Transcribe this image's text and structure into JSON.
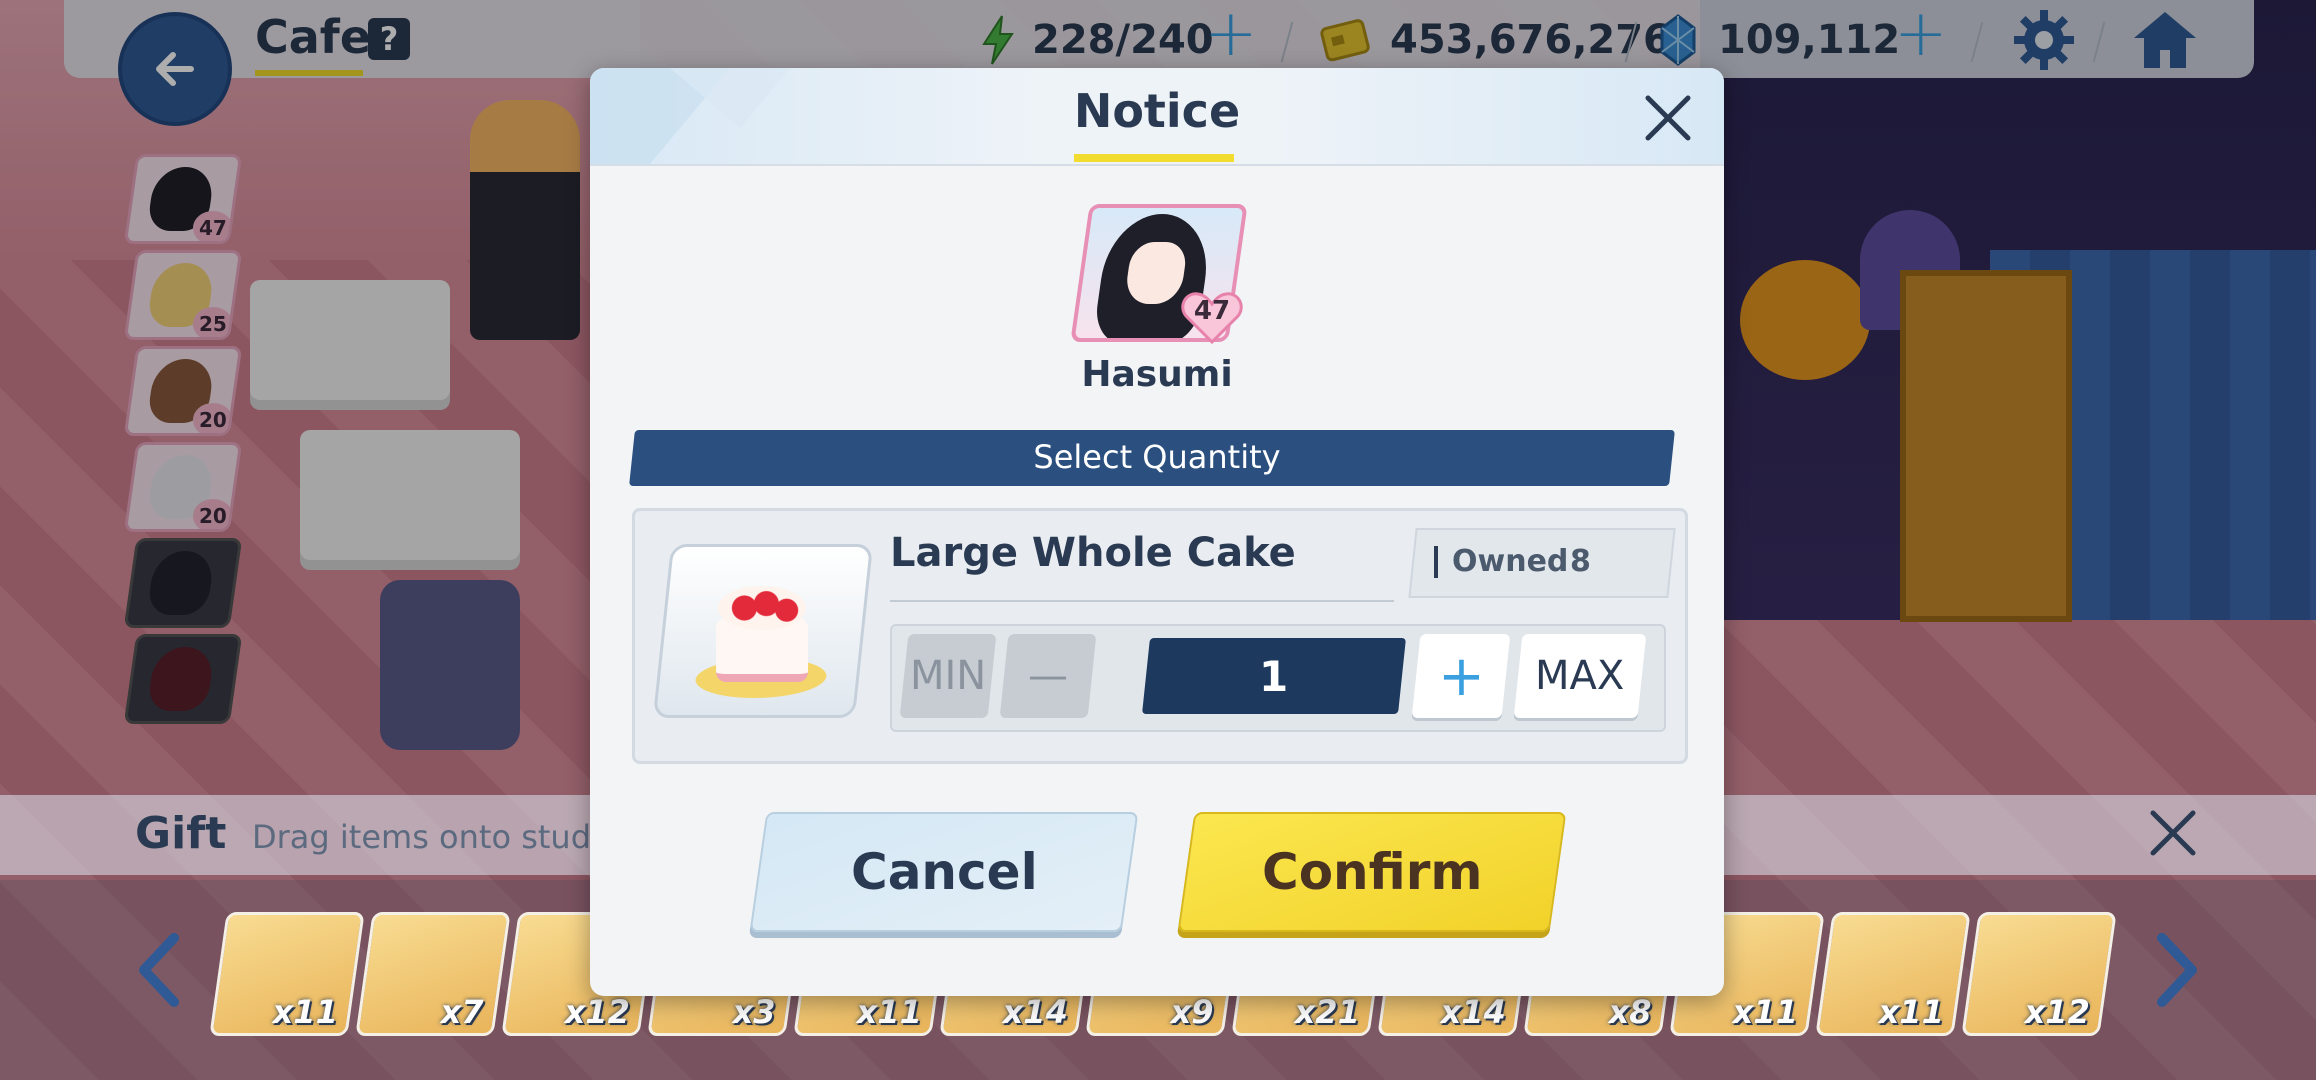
{
  "header": {
    "title": "Cafe",
    "help_label": "?",
    "ap": "228/240",
    "credits": "453,676,276",
    "pyroxene": "109,112"
  },
  "students": [
    {
      "level": "47"
    },
    {
      "level": "25"
    },
    {
      "level": "20"
    },
    {
      "level": "20"
    }
  ],
  "gift_panel": {
    "label": "Gift",
    "hint": "Drag items onto student",
    "items": [
      "x11",
      "x7",
      "x12",
      "x3",
      "x11",
      "x14",
      "x9",
      "x21",
      "x14",
      "x8",
      "x11",
      "x11",
      "x12"
    ]
  },
  "modal": {
    "title": "Notice",
    "student_name": "Hasumi",
    "student_level": "47",
    "banner": "Select Quantity",
    "item_name": "Large Whole Cake",
    "owned_label": "Owned",
    "owned_value": "8",
    "min_label": "MIN",
    "minus_label": "—",
    "quantity": "1",
    "plus_label": "+",
    "max_label": "MAX",
    "cancel_label": "Cancel",
    "confirm_label": "Confirm"
  },
  "colors": {
    "accent_yellow": "#f2dc2f",
    "navy": "#2b5080",
    "confirm": "#f7e04a",
    "cancel": "#d4e8f5"
  }
}
